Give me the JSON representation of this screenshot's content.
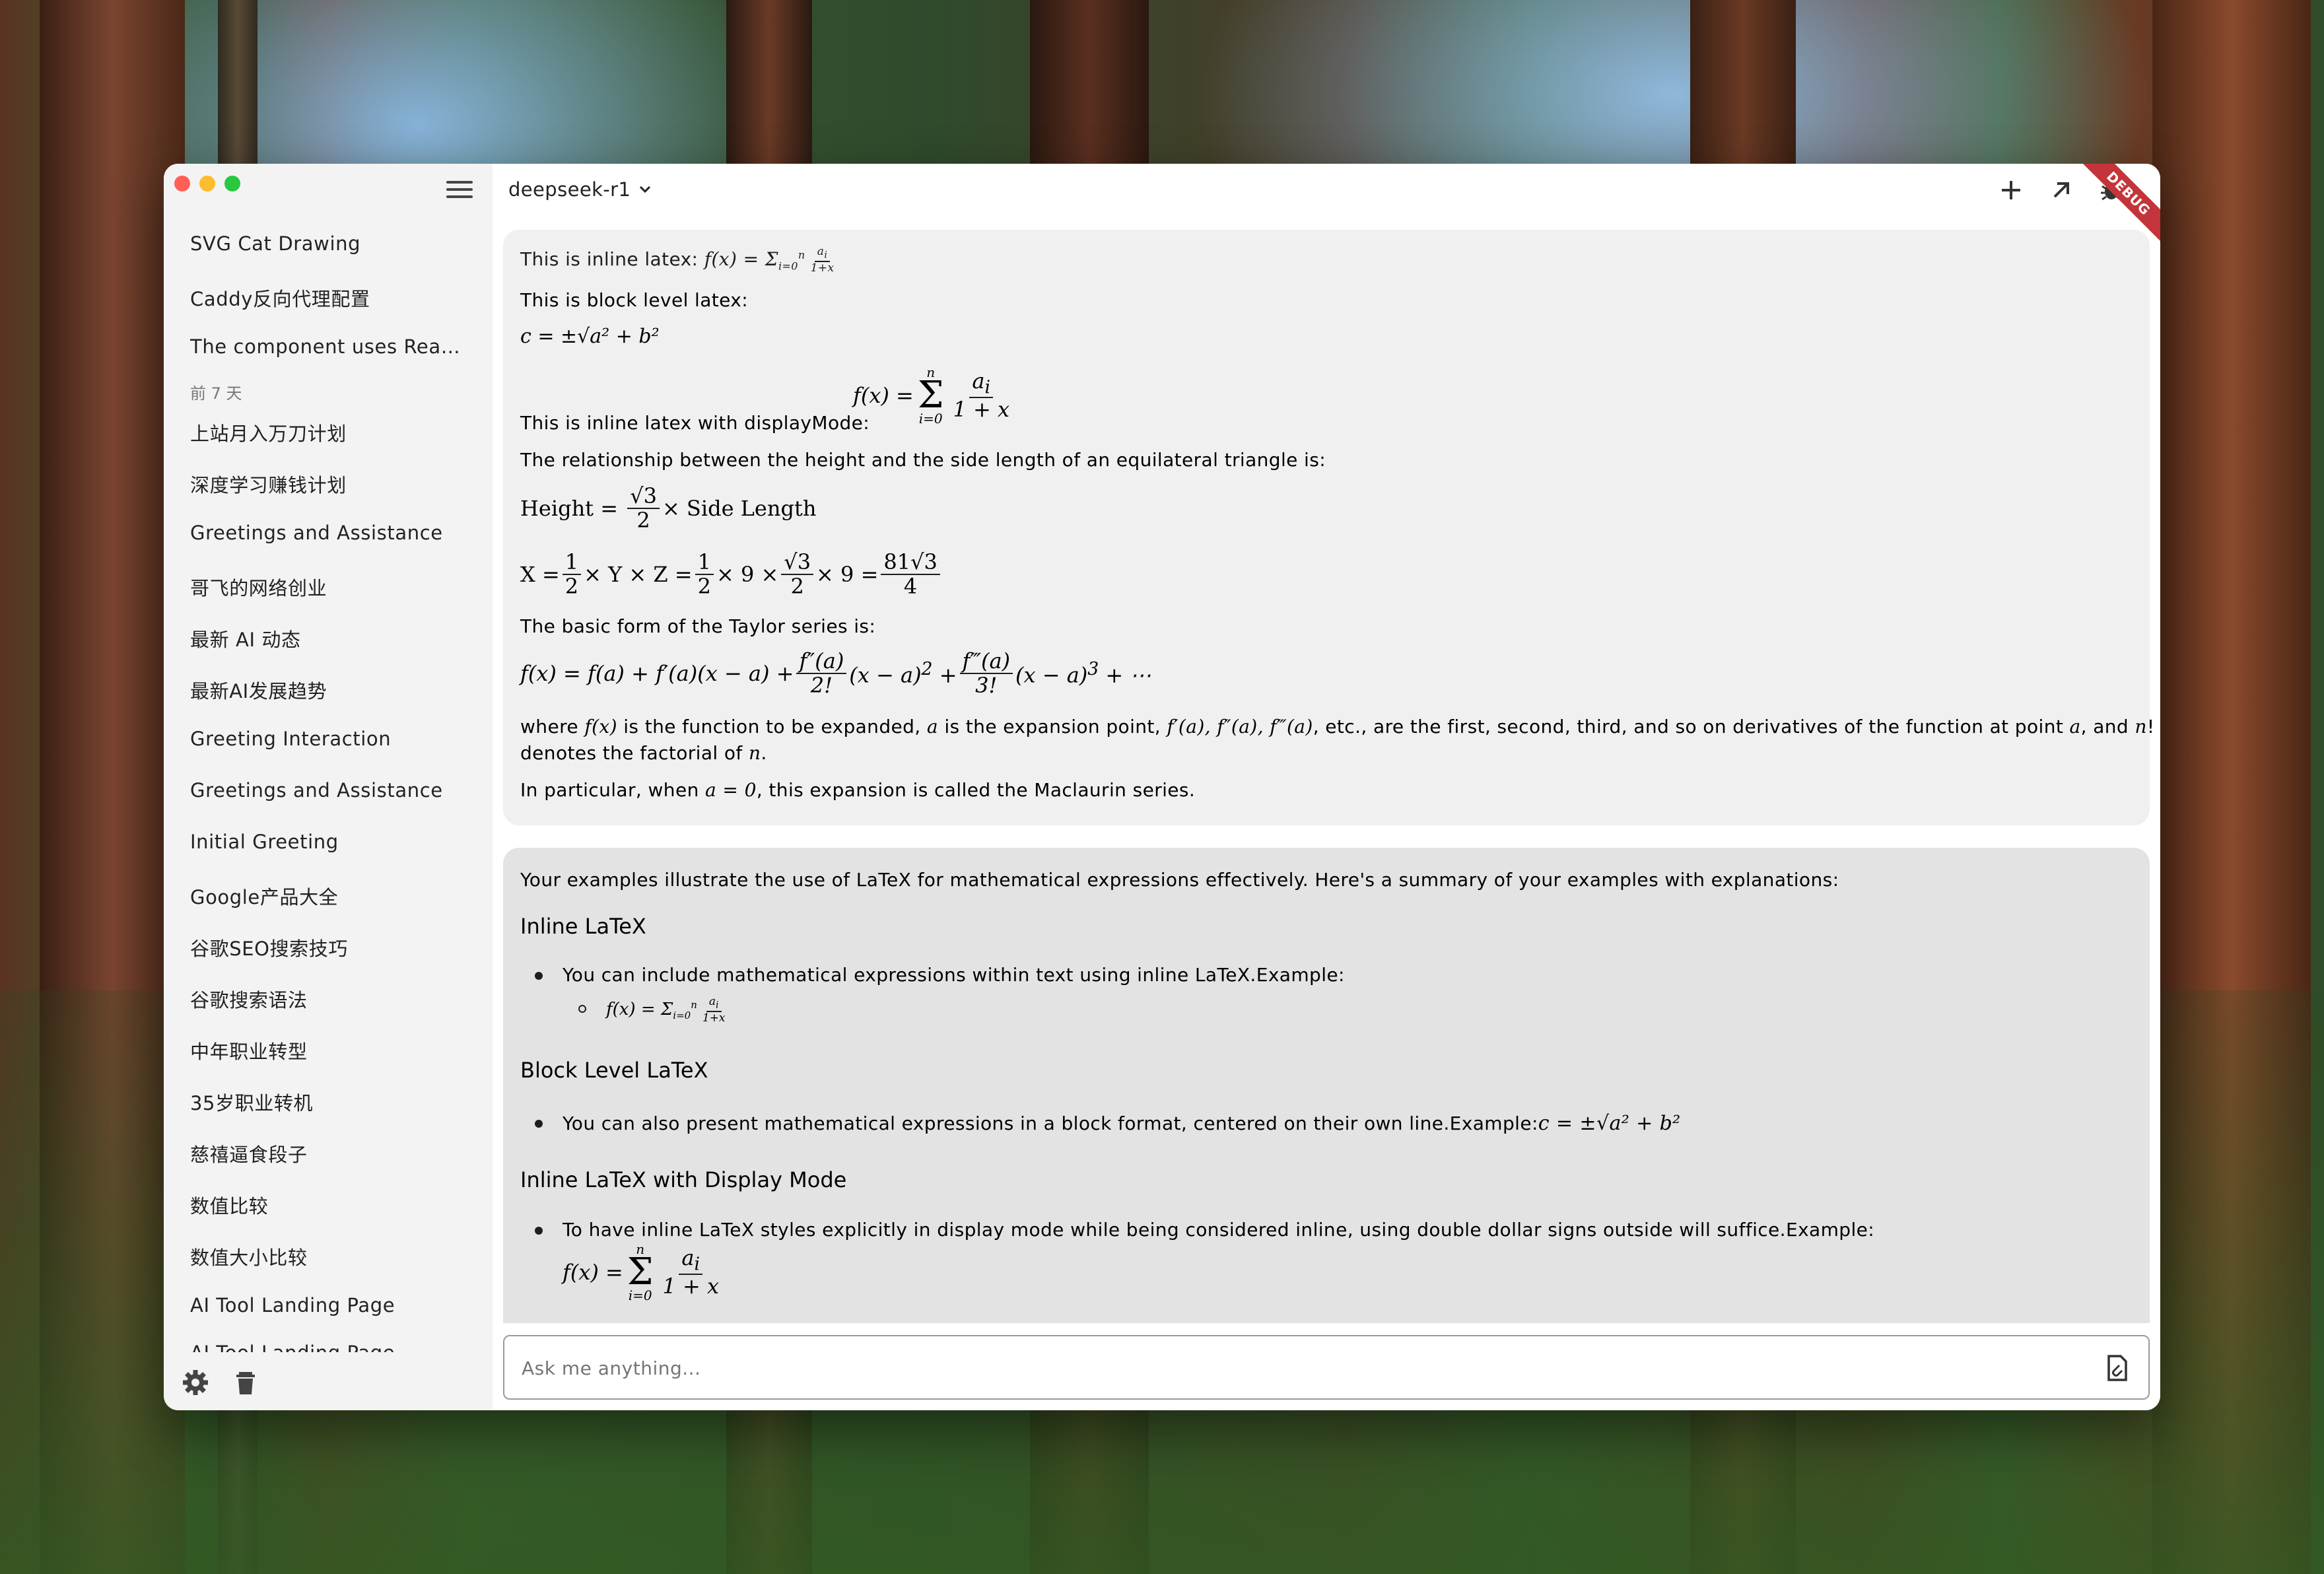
{
  "window": {
    "model": "deepseek-r1",
    "debug_label": "DEBUG"
  },
  "sidebar": {
    "items_top": [
      "SVG Cat Drawing",
      "Caddy反向代理配置",
      "The component uses Reac..."
    ],
    "group_label": "前 7 天",
    "items": [
      "上站月入万刀计划",
      "深度学习赚钱计划",
      "Greetings and Assistance",
      "哥飞的网络创业",
      "最新 AI 动态",
      "最新AI发展趋势",
      "Greeting Interaction",
      "Greetings and Assistance",
      "Initial Greeting",
      "Google产品大全",
      "谷歌SEO搜索技巧",
      "谷歌搜索语法",
      "中年职业转型",
      "35岁职业转机",
      "慈禧逼食段子",
      "数值比较",
      "数值大小比较",
      "AI Tool Landing Page",
      "AI Tool Landing Page"
    ],
    "icons": [
      "menu-icon",
      "settings-icon",
      "trash-icon"
    ]
  },
  "topbar": {
    "icons": [
      "plus-icon",
      "arrow-up-right-icon",
      "bug-icon",
      "chevron-down-icon"
    ]
  },
  "user_message": {
    "l1": "This is inline latex: ",
    "l2": "This is block level latex:",
    "l3_math": "c = ±√a² + b²",
    "l4": "This is inline latex with displayMode:",
    "l5": "The relationship between the height and the side length of an equilateral triangle is:",
    "height_word": "Height",
    "side_length": "× Side Length",
    "taylor_intro": "The basic form of the Taylor series is:",
    "where_1": "where",
    "where_2": "is the function to be expanded,",
    "where_3": "is the expansion point,",
    "where_4": ", etc., are the first, second, third, and so on derivatives of the function at point",
    "where_5": ", and",
    "where_6": "denotes the factorial of",
    "maclaurin_1": "In particular, when",
    "maclaurin_2": ", this expansion is called the Maclaurin series."
  },
  "assistant_message": {
    "intro": "Your examples illustrate the use of LaTeX for mathematical expressions effectively. Here's a summary of your examples with explanations:",
    "h1": "Inline LaTeX",
    "b1": "You can include mathematical expressions within text using inline LaTeX.Example:",
    "h2": "Block Level LaTeX",
    "b2": "You can also present mathematical expressions in a block format, centered on their own line.Example:",
    "h3": "Inline LaTeX with Display Mode",
    "b3": "To have inline LaTeX styles explicitly in display mode while being considered inline, using double dollar signs outside will suffice.Example:"
  },
  "input": {
    "placeholder": "Ask me anything..."
  }
}
